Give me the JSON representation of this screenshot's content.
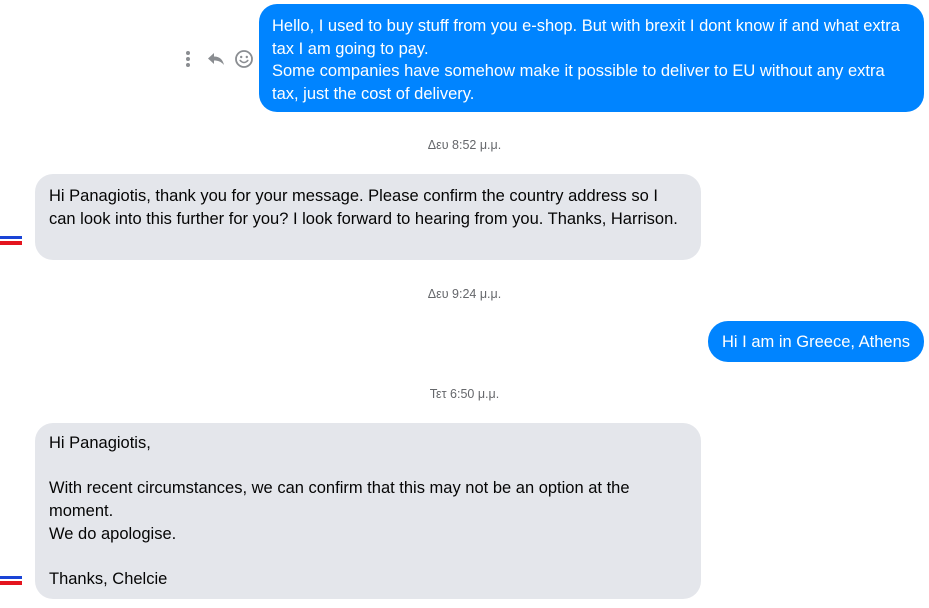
{
  "conversation": {
    "messages": [
      {
        "direction": "outgoing",
        "text": "Hello, I used to buy stuff from you e-shop. But with brexit I dont know if and what extra tax I am going to pay.\nSome companies have somehow make it possible to deliver to EU without any extra tax, just the cost of delivery."
      },
      {
        "direction": "incoming",
        "text": "Hi Panagiotis, thank you for your message. Please confirm the country address so I can look into this further for you? I look forward to hearing from you. Thanks, Harrison."
      },
      {
        "direction": "outgoing",
        "text": "Hi I am in Greece, Athens"
      },
      {
        "direction": "incoming",
        "text": "Hi Panagiotis,\n\nWith recent circumstances, we can confirm that this may not be an option at the moment.\nWe do apologise.\n\nThanks, Chelcie"
      }
    ],
    "timestamps": [
      "Δευ 8:52 μ.μ.",
      "Δευ 9:24 μ.μ.",
      "Τετ 6:50 μ.μ."
    ],
    "message_actions": {
      "icons": [
        "more-options-icon",
        "reply-icon",
        "react-emoji-icon"
      ]
    }
  },
  "colors": {
    "outgoing_bubble": "#0084ff",
    "incoming_bubble": "#e4e6eb",
    "timestamp_text": "#65676b",
    "avatar_flag_blue": "#1a44d6",
    "avatar_flag_red": "#e4141e"
  }
}
